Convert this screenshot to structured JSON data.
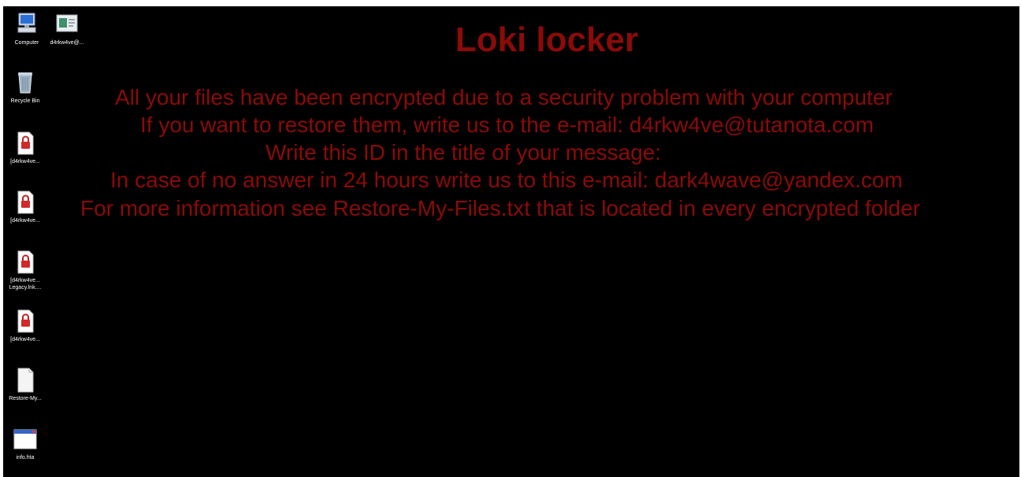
{
  "desktop": {
    "icons": [
      {
        "name": "computer-icon",
        "label": "Computer"
      },
      {
        "name": "contact-file-icon",
        "label": "d4rkw4ve@..."
      },
      {
        "name": "recycle-bin-icon",
        "label": "Recycle Bin"
      },
      {
        "name": "locked-file-icon",
        "label": "[d4rkw4ve..."
      },
      {
        "name": "locked-file-icon",
        "label": "[d4rkw4ve..."
      },
      {
        "name": "locked-file-icon",
        "label": "[d4rkw4ve...\nLegacy.lnk...."
      },
      {
        "name": "locked-file-icon",
        "label": "[d4rkw4ve..."
      },
      {
        "name": "text-file-icon",
        "label": "Restore-My..."
      },
      {
        "name": "hta-window-icon",
        "label": "info.hta"
      }
    ]
  },
  "ransom_note": {
    "title": "Loki locker",
    "lines": [
      "All your files have been encrypted due to a security problem with your computer",
      "If you want to restore them, write us to the e-mail: d4rkw4ve@tutanota.com",
      "Write this ID in the title of your message:",
      "In case of no answer in 24 hours write us to this e-mail: dark4wave@yandex.com",
      "For more information see Restore-My-Files.txt that is located in every encrypted folder"
    ]
  },
  "colors": {
    "background": "#000000",
    "note_text": "#8b0b08",
    "icon_label": "#ffffff"
  }
}
